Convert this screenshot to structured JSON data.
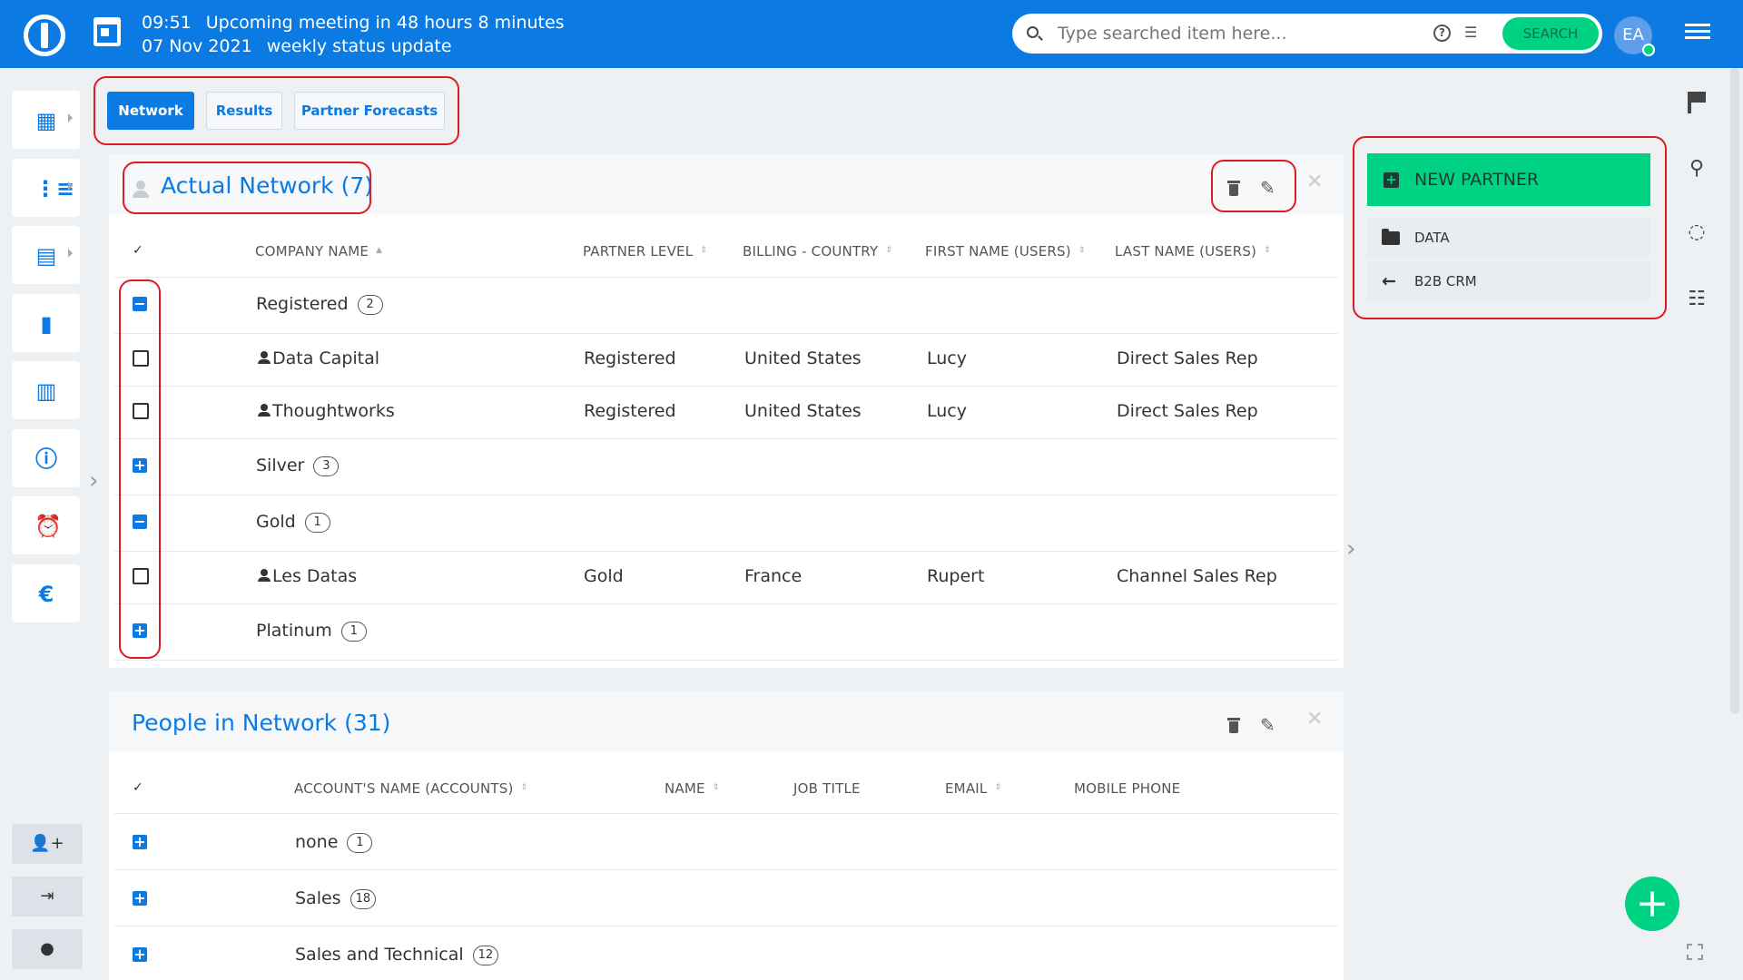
{
  "topbar": {
    "time": "09:51",
    "meeting": "Upcoming meeting in 48 hours 8 minutes",
    "date": "07 Nov 2021",
    "meeting_title": "weekly status update",
    "search_placeholder": "Type searched item here...",
    "search_button": "SEARCH",
    "avatar_initials": "EA",
    "brand_color": "#0b7be3",
    "accent_color": "#00d283"
  },
  "tabs": [
    {
      "label": "Network",
      "active": true
    },
    {
      "label": "Results",
      "active": false
    },
    {
      "label": "Partner Forecasts",
      "active": false
    }
  ],
  "actual_network": {
    "title": "Actual Network (7)",
    "columns": {
      "check": "✓",
      "company": "COMPANY NAME",
      "level": "PARTNER LEVEL",
      "country": "BILLING - COUNTRY",
      "first": "FIRST NAME (USERS)",
      "last": "LAST NAME (USERS)"
    },
    "groups": {
      "registered": {
        "label": "Registered",
        "count": "2"
      },
      "silver": {
        "label": "Silver",
        "count": "3"
      },
      "gold": {
        "label": "Gold",
        "count": "1"
      },
      "platinum": {
        "label": "Platinum",
        "count": "1"
      }
    },
    "rows": [
      {
        "company": "Data Capital",
        "level": "Registered",
        "country": "United States",
        "first": "Lucy",
        "last": "Direct Sales Rep"
      },
      {
        "company": "Thoughtworks",
        "level": "Registered",
        "country": "United States",
        "first": "Lucy",
        "last": "Direct Sales Rep"
      },
      {
        "company": "Les Datas",
        "level": "Gold",
        "country": "France",
        "first": "Rupert",
        "last": "Channel Sales Rep"
      }
    ]
  },
  "people_network": {
    "title": "People in Network (31)",
    "columns": {
      "check": "✓",
      "account": "ACCOUNT'S NAME (ACCOUNTS)",
      "name": "NAME",
      "job": "JOB TITLE",
      "email": "EMAIL",
      "mobile": "MOBILE PHONE"
    },
    "groups": [
      {
        "label": "none",
        "count": "1"
      },
      {
        "label": "Sales",
        "count": "18"
      },
      {
        "label": "Sales and Technical",
        "count": "12"
      }
    ]
  },
  "right_panel": {
    "new_partner": "NEW PARTNER",
    "links": [
      "DATA",
      "B2B CRM"
    ]
  }
}
